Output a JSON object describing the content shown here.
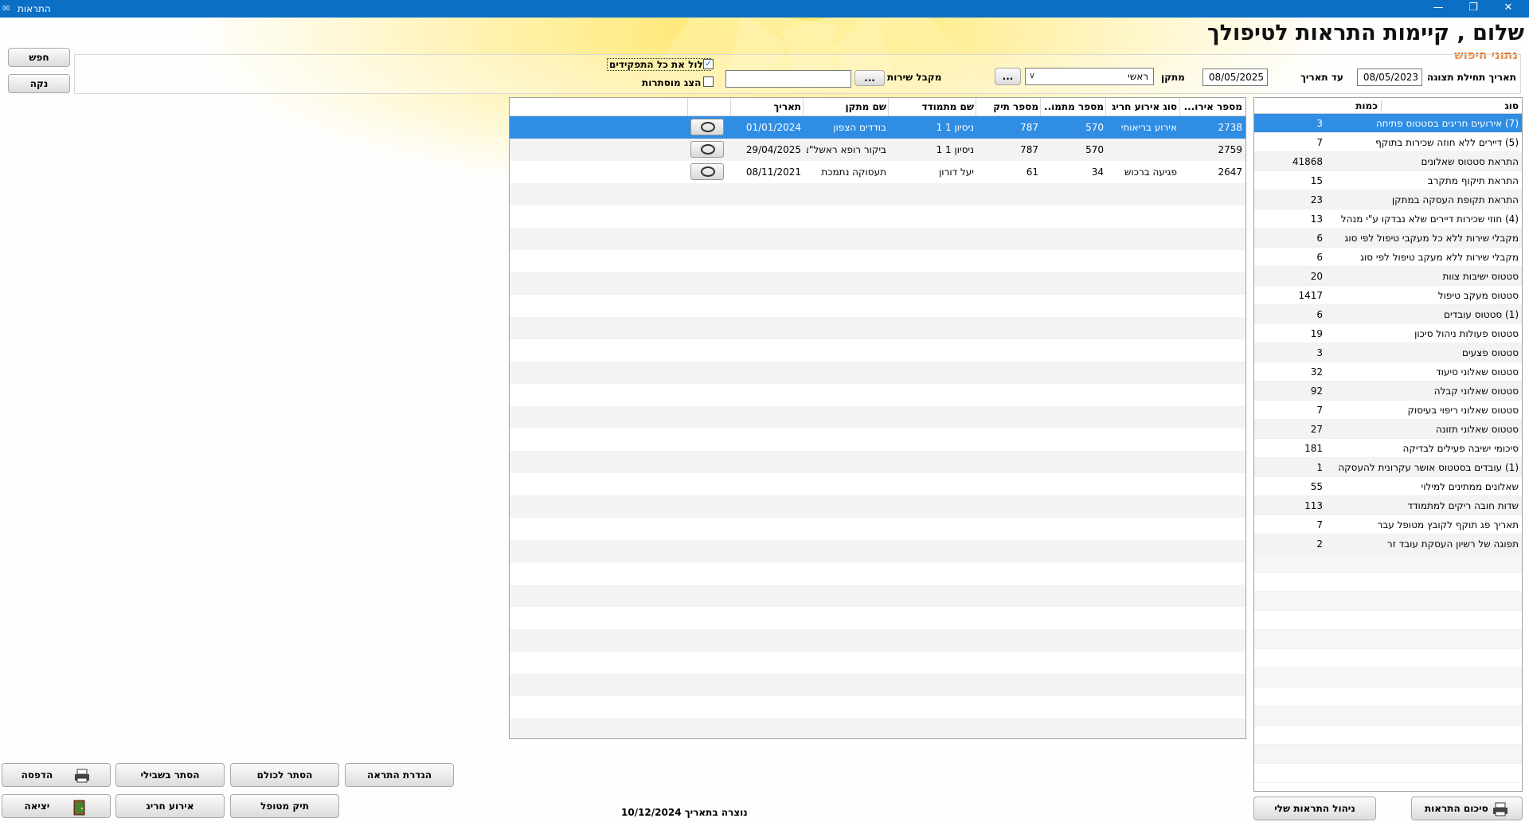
{
  "window": {
    "title": "התראות"
  },
  "header": {
    "title": "שלום , קיימות התראות לטיפולך",
    "subtitle": "נתוני חיפוש"
  },
  "filters": {
    "from_date_label": "תאריך תחילת תצוגה",
    "from_date": "08/05/2023",
    "to_date_label": "עד תאריך",
    "to_date": "08/05/2025",
    "facility_label": "מתקן",
    "facility_value": "ראשי",
    "browse_label": "...",
    "service_receiver_label": "מקבל שירות",
    "service_receiver_value": "",
    "include_all_roles_label": "כלול את כל התפקידים",
    "include_all_roles_checked": true,
    "show_hidden_label": "הצג מוסתרות",
    "show_hidden_checked": false,
    "search_button": "חפש",
    "clear_button": "נקה"
  },
  "summary_list": {
    "col_type": "סוג",
    "col_count": "כמות",
    "rows": [
      {
        "name": "(7) אירועים חריגים בסטטוס פתיחה",
        "count": "3"
      },
      {
        "name": "(5) דיירים ללא חוזה שכירות בתוקף",
        "count": "7"
      },
      {
        "name": "התראת סטטוס שאלונים",
        "count": "41868"
      },
      {
        "name": "התראת תיקוף מתקרב",
        "count": "15"
      },
      {
        "name": "התראת תקופת העסקה במתקן",
        "count": "23"
      },
      {
        "name": "(4) חוזי שכירות דיירים שלא נבדקו ע\"י מנהל",
        "count": "13"
      },
      {
        "name": "מקבלי שירות ללא כל מעקבי טיפול לפי סוג",
        "count": "6"
      },
      {
        "name": "מקבלי שירות ללא מעקב טיפול לפי סוג",
        "count": "6"
      },
      {
        "name": "סטטוס ישיבות צוות",
        "count": "20"
      },
      {
        "name": "סטטוס מעקב טיפול",
        "count": "1417"
      },
      {
        "name": "(1) סטטוס עובדים",
        "count": "6"
      },
      {
        "name": "סטטוס פעולות ניהול סיכון",
        "count": "19"
      },
      {
        "name": "סטטוס פצעים",
        "count": "3"
      },
      {
        "name": "סטטוס שאלוני סיעוד",
        "count": "32"
      },
      {
        "name": "סטטוס שאלוני קבלה",
        "count": "92"
      },
      {
        "name": "סטטוס שאלוני ריפוי בעיסוק",
        "count": "7"
      },
      {
        "name": "סטטוס שאלוני תזונה",
        "count": "27"
      },
      {
        "name": "סיכומי ישיבה פעילים לבדיקה",
        "count": "181"
      },
      {
        "name": "(1) עובדים בסטטוס אושר עקרונית להעסקה",
        "count": "1"
      },
      {
        "name": "שאלונים ממתינים למילוי",
        "count": "55"
      },
      {
        "name": "שדות חובה ריקים למתמודד",
        "count": "113"
      },
      {
        "name": "תאריך פג תוקף לקובץ מטופל עבר",
        "count": "7"
      },
      {
        "name": "תפוגה של רשיון העסקת עובד זר",
        "count": "2"
      }
    ]
  },
  "events_grid": {
    "columns": {
      "event_no": "מספר אירו...",
      "event_type": "סוג אירוע חריג",
      "patient_no": "מספר מתמו...",
      "file_no": "מספר תיק",
      "patient_name": "שם מתמודד",
      "facility_name": "שם מתקן",
      "date": "תאריך"
    },
    "rows": [
      {
        "event_no": "2738",
        "event_type": "אירוע בריאותי",
        "patient_no": "570",
        "file_no": "787",
        "patient_name": "ניסיון 1 1",
        "facility_name": "בודדים הצפון",
        "date": "01/01/2024"
      },
      {
        "event_no": "2759",
        "event_type": "",
        "patient_no": "570",
        "file_no": "787",
        "patient_name": "ניסיון 1 1",
        "facility_name": "ביקור רופא ראשל\"צ",
        "date": "29/04/2025"
      },
      {
        "event_no": "2647",
        "event_type": "פגיעה ברכוש",
        "patient_no": "34",
        "file_no": "61",
        "patient_name": "יעל דורון",
        "facility_name": "תעסוקה נתמכת",
        "date": "08/11/2021"
      }
    ]
  },
  "footer": {
    "alerts_summary_button": "סיכום התראות",
    "manage_my_alerts_button": "ניהול התראות שלי",
    "created_on": "נוצרה בתאריך 10/12/2024",
    "define_alert_button": "הגדרת התראה",
    "hide_for_all_button": "הסתר לכולם",
    "hide_for_me_button": "הסתר בשבילי",
    "print_button": "הדפסה",
    "patient_file_button": "תיק מטופל",
    "exception_event_button": "אירוע חריג",
    "exit_button": "יציאה"
  },
  "colors": {
    "titlebar": "#0b6fc6",
    "selection": "#2f8de4",
    "subtitle": "#e26a10"
  }
}
